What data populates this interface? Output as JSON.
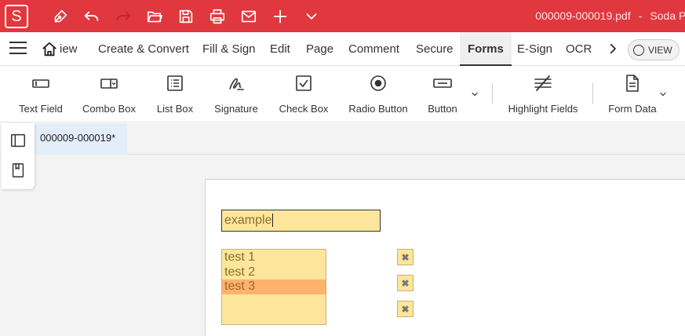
{
  "app": {
    "logo_letter": "S",
    "doc_file": "000009-000019.pdf",
    "app_name": "Soda PDF"
  },
  "theme": {
    "accent": "#e1373e",
    "field_fill": "#fde69b",
    "field_selected": "#fdb26e"
  },
  "quick_access": [
    "pen-icon",
    "undo-icon",
    "redo-icon",
    "open-folder-icon",
    "save-icon",
    "print-icon",
    "email-icon",
    "plus-icon",
    "chevron-down-icon"
  ],
  "menu": {
    "home_label": "iew",
    "tabs": [
      "Create & Convert",
      "Fill & Sign",
      "Edit",
      "Page",
      "Comment",
      "Secure",
      "Forms",
      "E-Sign",
      "OCR"
    ],
    "active_tab": "Forms",
    "view_label": "VIEW"
  },
  "ribbon": {
    "tools": [
      {
        "label": "Text Field",
        "icon": "text-field-icon"
      },
      {
        "label": "Combo Box",
        "icon": "combo-box-icon"
      },
      {
        "label": "List Box",
        "icon": "list-box-icon"
      },
      {
        "label": "Signature",
        "icon": "signature-icon"
      },
      {
        "label": "Check Box",
        "icon": "check-box-icon"
      },
      {
        "label": "Radio Button",
        "icon": "radio-button-icon"
      },
      {
        "label": "Button",
        "icon": "button-icon"
      },
      {
        "label": "Highlight Fields",
        "icon": "highlight-fields-icon"
      },
      {
        "label": "Form Data",
        "icon": "form-data-icon"
      }
    ]
  },
  "document": {
    "tab_label": "000009-000019*",
    "text_field_value": "example",
    "list_box": {
      "options": [
        "test 1",
        "test 2",
        "test 3"
      ],
      "selected_index": 2
    },
    "check_boxes": [
      {
        "mark": "✖"
      },
      {
        "mark": "✖"
      },
      {
        "mark": "✖"
      }
    ]
  }
}
